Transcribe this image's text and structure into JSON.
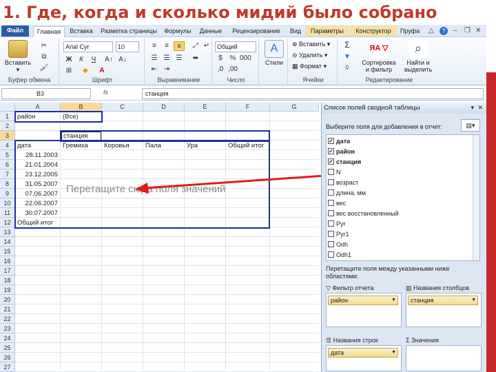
{
  "slide": {
    "title": "1. Где, когда и сколько мидий было собрано"
  },
  "ribbon": {
    "tabs": [
      "Файл",
      "Главная",
      "Вставка",
      "Разметка страницы",
      "Формулы",
      "Данные",
      "Рецензирование",
      "Вид",
      "Параметры",
      "Конструктор",
      "Пруфа"
    ],
    "groups": {
      "clipboard": "Буфер обмена",
      "font": "Шрифт",
      "alignment": "Выравнивание",
      "number": "Число",
      "styles": "Стили",
      "cells": "Ячейки",
      "editing": "Редактирование"
    },
    "paste_label": "Вставить",
    "font_name": "Arial Cyr",
    "font_size": "10",
    "number_format": "Общий",
    "styles_label": "Стили",
    "insert_label": "Вставить",
    "delete_label": "Удалить",
    "format_label": "Формат",
    "sort_label": "Сортировка и фильтр",
    "find_label": "Найти и выделить"
  },
  "formula_bar": {
    "name_box": "B3",
    "fx": "fx",
    "value": "станция"
  },
  "grid": {
    "columns": [
      "A",
      "B",
      "C",
      "D",
      "E",
      "F",
      "G"
    ],
    "rows": [
      "1",
      "2",
      "3",
      "4",
      "5",
      "6",
      "7",
      "8",
      "9",
      "10",
      "11",
      "12",
      "13",
      "14",
      "15",
      "16",
      "17",
      "18",
      "19",
      "20",
      "21",
      "22",
      "23",
      "24",
      "25",
      "26",
      "27"
    ],
    "cells": {
      "a1": "район",
      "b1": "(Все)",
      "b3": "станция",
      "a4": "дата",
      "b4": "Гремиха",
      "c4": "Коровья",
      "d4": "Пала",
      "e4": "Ура",
      "f4": "Общий итог",
      "a5": "28.11.2003",
      "a6": "21.01.2004",
      "a7": "23.12.2005",
      "a8": "31.05.2007",
      "a9": "07.06.2007",
      "a10": "22.06.2007",
      "a11": "30.07.2007",
      "a12": "Общий итог"
    },
    "drop_hint": "Перетащите сюда поля значений"
  },
  "pivot_panel": {
    "title": "Список полей сводной таблицы",
    "choose_label": "Выберите поля для добавления в отчет:",
    "fields": [
      {
        "name": "дата",
        "checked": true
      },
      {
        "name": "район",
        "checked": true
      },
      {
        "name": "станция",
        "checked": true
      },
      {
        "name": "N",
        "checked": false
      },
      {
        "name": "возраст",
        "checked": false
      },
      {
        "name": "длина, мм",
        "checked": false
      },
      {
        "name": "вес",
        "checked": false
      },
      {
        "name": "вес восстановленный",
        "checked": false
      },
      {
        "name": "Pyr",
        "checked": false
      },
      {
        "name": "Pyr1",
        "checked": false
      },
      {
        "name": "Odh",
        "checked": false
      },
      {
        "name": "Odh1",
        "checked": false
      }
    ],
    "drag_label": "Перетащите поля между указанными ниже областями:",
    "areas": {
      "filter": {
        "label": "Фильтр отчета",
        "chip": "район"
      },
      "columns": {
        "label": "Названия столбцов",
        "chip": "станция"
      },
      "rows": {
        "label": "Названия строк",
        "chip": "дата"
      },
      "values": {
        "label": "Значения",
        "chip": ""
      }
    }
  }
}
